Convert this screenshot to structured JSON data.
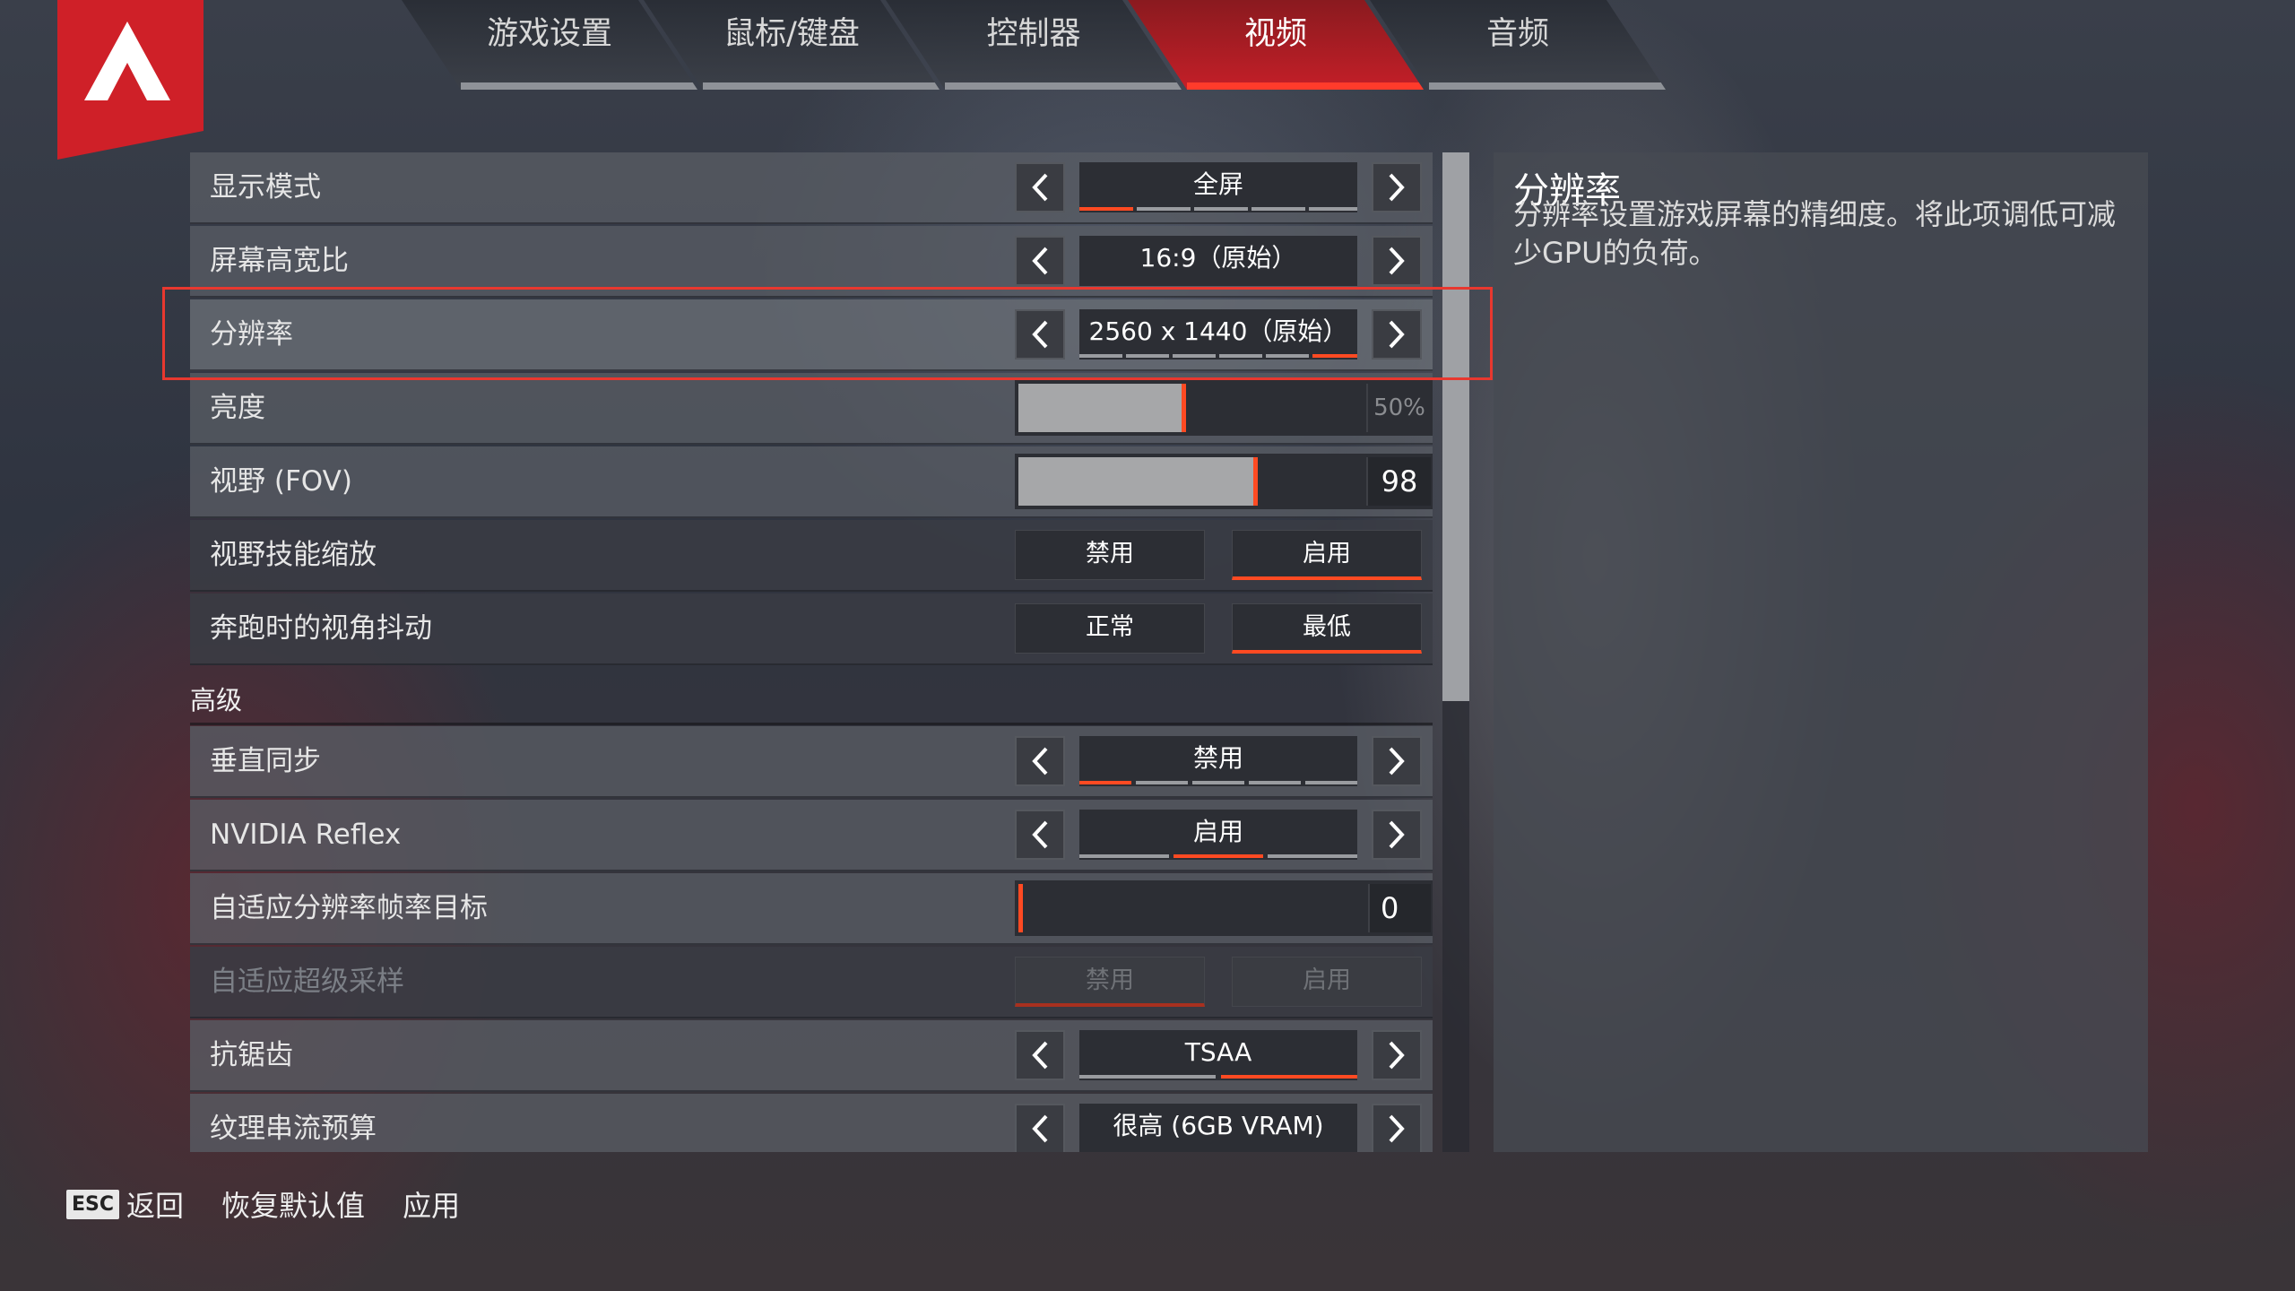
{
  "tabs": [
    {
      "label": "游戏设置",
      "active": false
    },
    {
      "label": "鼠标/键盘",
      "active": false
    },
    {
      "label": "控制器",
      "active": false
    },
    {
      "label": "视频",
      "active": true
    },
    {
      "label": "音频",
      "active": false
    }
  ],
  "settings": {
    "display_mode": {
      "label": "显示模式",
      "value": "全屏",
      "segments": 5,
      "selected_segment": 1
    },
    "aspect_ratio": {
      "label": "屏幕高宽比",
      "value": "16:9（原始）"
    },
    "resolution": {
      "label": "分辨率",
      "value": "2560 x 1440（原始）",
      "segments": 6,
      "selected_segment": 6
    },
    "brightness": {
      "label": "亮度",
      "value": "50%",
      "level_percent": 50
    },
    "fov": {
      "label": "视野 (FOV)",
      "value": "98",
      "level_percent": 70
    },
    "ability_fov_scaling": {
      "label": "视野技能缩放",
      "options": [
        "禁用",
        "启用"
      ],
      "selected": "启用"
    },
    "sprint_view_shake": {
      "label": "奔跑时的视角抖动",
      "options": [
        "正常",
        "最低"
      ],
      "selected": "最低"
    }
  },
  "advanced": {
    "section_title": "高级",
    "vsync": {
      "label": "垂直同步",
      "value": "禁用",
      "segments": 5,
      "selected_segment": 1
    },
    "nvidia_reflex": {
      "label": "NVIDIA Reflex",
      "value": "启用",
      "segments": 3,
      "selected_segment": 2
    },
    "adaptive_res_target": {
      "label": "自适应分辨率帧率目标",
      "value": "0",
      "level_percent": 0
    },
    "adaptive_supersampling": {
      "label": "自适应超级采样",
      "options": [
        "禁用",
        "启用"
      ],
      "selected": "禁用",
      "disabled": true
    },
    "anti_aliasing": {
      "label": "抗锯齿",
      "value": "TSAA",
      "segments": 2,
      "selected_segment": 2
    },
    "texture_budget": {
      "label": "纹理串流预算",
      "value": "很高 (6GB VRAM)"
    }
  },
  "description": {
    "title": "分辨率",
    "body": "分辨率设置游戏屏幕的精细度。将此项调低可减少GPU的负荷。"
  },
  "footer": {
    "esc_key": "ESC",
    "back": "返回",
    "reset": "恢复默认值",
    "apply": "应用"
  },
  "colors": {
    "accent": "#ff4a22",
    "brand_red": "#cf2028",
    "highlight": "#e8382f"
  },
  "icons": {
    "logo": "apex-logo-icon",
    "prev": "chevron-left-icon",
    "next": "chevron-right-icon"
  }
}
